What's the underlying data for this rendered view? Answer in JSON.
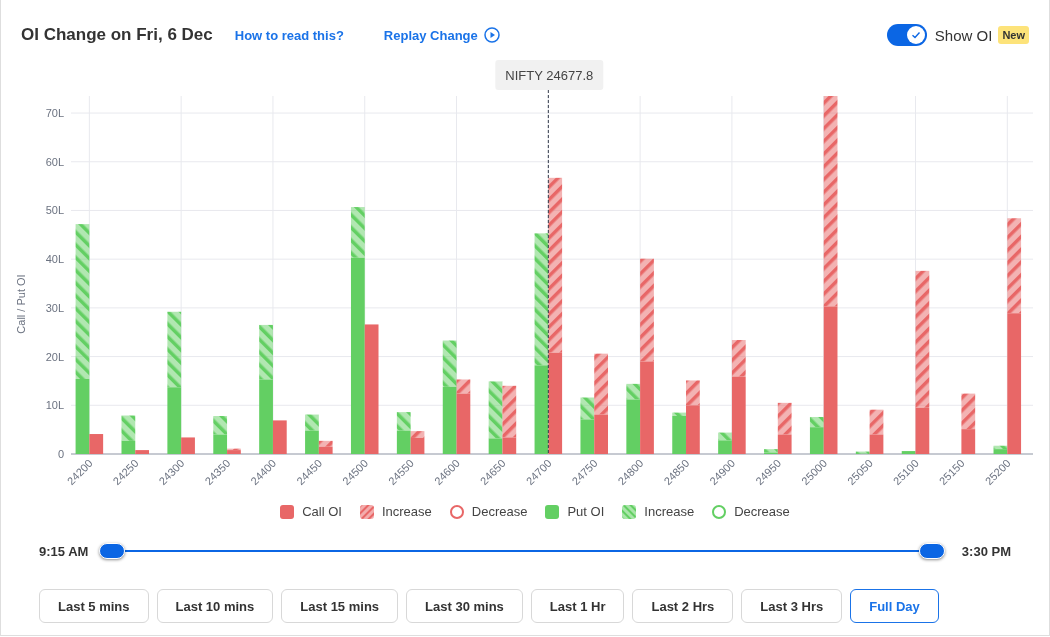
{
  "header": {
    "title": "OI Change on Fri, 6 Dec",
    "help_link": "How to read this?",
    "replay_link": "Replay Change",
    "toggle": {
      "label": "Show OI",
      "on": true,
      "badge": "New"
    }
  },
  "chart_data": {
    "type": "bar",
    "ylabel": "Call / Put OI",
    "stacked": true,
    "grid": true,
    "x": [
      24192.5,
      24207.5,
      24242.5,
      24257.5,
      24292.5,
      24307.5,
      24342.5,
      24357.5,
      24392.5,
      24407.5,
      24442.5,
      24457.5,
      24492.5,
      24507.5,
      24542.5,
      24557.5,
      24592.5,
      24607.5,
      24642.5,
      24657.5,
      24692.5,
      24707.5,
      24742.5,
      24757.5,
      24792.5,
      24807.5,
      24842.5,
      24857.5,
      24892.5,
      24907.5,
      24942.5,
      24957.5,
      24992.5,
      25007.5,
      25042.5,
      25057.5,
      25092.5,
      25107.5,
      25142.5,
      25157.5,
      25192.5,
      25207.5
    ],
    "series": [
      {
        "name": "Put OI",
        "color": "#63cf63",
        "values": [
          15.4,
          null,
          2.7,
          null,
          13.7,
          null,
          4.0,
          null,
          15.3,
          null,
          4.8,
          null,
          40.3,
          null,
          4.8,
          null,
          13.8,
          null,
          3.2,
          null,
          18.2,
          null,
          7.1,
          null,
          11.2,
          null,
          7.8,
          null,
          2.8,
          null,
          0.3,
          null,
          5.5,
          null,
          null,
          null,
          0.6,
          null,
          0,
          null,
          1.0,
          null
        ]
      },
      {
        "name": "Increase",
        "color": "#63cf63",
        "values": [
          31.8,
          null,
          5.2,
          null,
          15.5,
          null,
          3.8,
          null,
          11.2,
          null,
          3.3,
          null,
          10.4,
          null,
          3.8,
          null,
          9.5,
          null,
          11.7,
          null,
          27.1,
          null,
          4.5,
          null,
          3.2,
          null,
          0.7,
          null,
          1.6,
          null,
          0.7,
          null,
          2.1,
          null,
          0.5,
          null,
          0,
          null,
          0,
          null,
          0.7,
          null
        ]
      },
      {
        "name": "Call OI",
        "color": "#e86767",
        "values": [
          null,
          4.1,
          null,
          0.8,
          null,
          3.4,
          null,
          0.8,
          null,
          6.9,
          null,
          1.5,
          null,
          26.6,
          null,
          3.3,
          null,
          12.4,
          null,
          3.4,
          null,
          20.8,
          null,
          8.1,
          null,
          19.0,
          null,
          10.0,
          null,
          15.9,
          null,
          4.0,
          null,
          30.3,
          null,
          4.0,
          null,
          9.5,
          null,
          5.1,
          null,
          28.9
        ]
      },
      {
        "name": "Increase",
        "color": "#e86767",
        "values": [
          null,
          0,
          null,
          0,
          null,
          0,
          null,
          0.3,
          null,
          0,
          null,
          1.2,
          null,
          0,
          null,
          1.4,
          null,
          2.9,
          null,
          10.6,
          null,
          35.9,
          null,
          12.5,
          null,
          21.1,
          null,
          5.1,
          null,
          7.5,
          null,
          6.5,
          null,
          43.2,
          null,
          5.1,
          null,
          28.1,
          null,
          7.3,
          null,
          19.5
        ]
      }
    ],
    "xlim": [
      24180,
      25228
    ],
    "ylim": [
      0,
      73.5
    ],
    "xticks": [
      24200,
      24250,
      24300,
      24350,
      24400,
      24450,
      24500,
      24550,
      24600,
      24650,
      24700,
      24750,
      24800,
      24850,
      24900,
      24950,
      25000,
      25050,
      25100,
      25150,
      25200
    ],
    "yticks": [
      {
        "value": 0,
        "label": "0"
      },
      {
        "value": 10,
        "label": "10L"
      },
      {
        "value": 20,
        "label": "20L"
      },
      {
        "value": 30,
        "label": "30L"
      },
      {
        "value": 40,
        "label": "40L"
      },
      {
        "value": 50,
        "label": "50L"
      },
      {
        "value": 60,
        "label": "60L"
      },
      {
        "value": 70,
        "label": "70L"
      }
    ],
    "ref_lines": [
      {
        "axis": "x",
        "value": 24700,
        "label": "NIFTY 24677.8"
      }
    ]
  },
  "legend": [
    {
      "kind": "solid"
    },
    {
      "kind": "hatched"
    },
    {
      "label": "Decrease",
      "kind": "hollow",
      "color": "#e86767"
    },
    {
      "kind": "solid"
    },
    {
      "kind": "hatched"
    },
    {
      "label": "Decrease",
      "kind": "hollow",
      "color": "#63cf63"
    }
  ],
  "slider": {
    "start": "9:15 AM",
    "end": "3:30 PM",
    "thumbs": [
      {
        "level": 0
      },
      {
        "level": 1
      }
    ]
  },
  "ranges": [
    {
      "label": "Last 5 mins",
      "selected": false
    },
    {
      "label": "Last 10 mins",
      "selected": false
    },
    {
      "label": "Last 15 mins",
      "selected": false
    },
    {
      "label": "Last 30 mins",
      "selected": false
    },
    {
      "label": "Last 1 Hr",
      "selected": false
    },
    {
      "label": "Last 2 Hrs",
      "selected": false
    },
    {
      "label": "Last 3 Hrs",
      "selected": false
    },
    {
      "label": "Full Day",
      "selected": true
    }
  ]
}
